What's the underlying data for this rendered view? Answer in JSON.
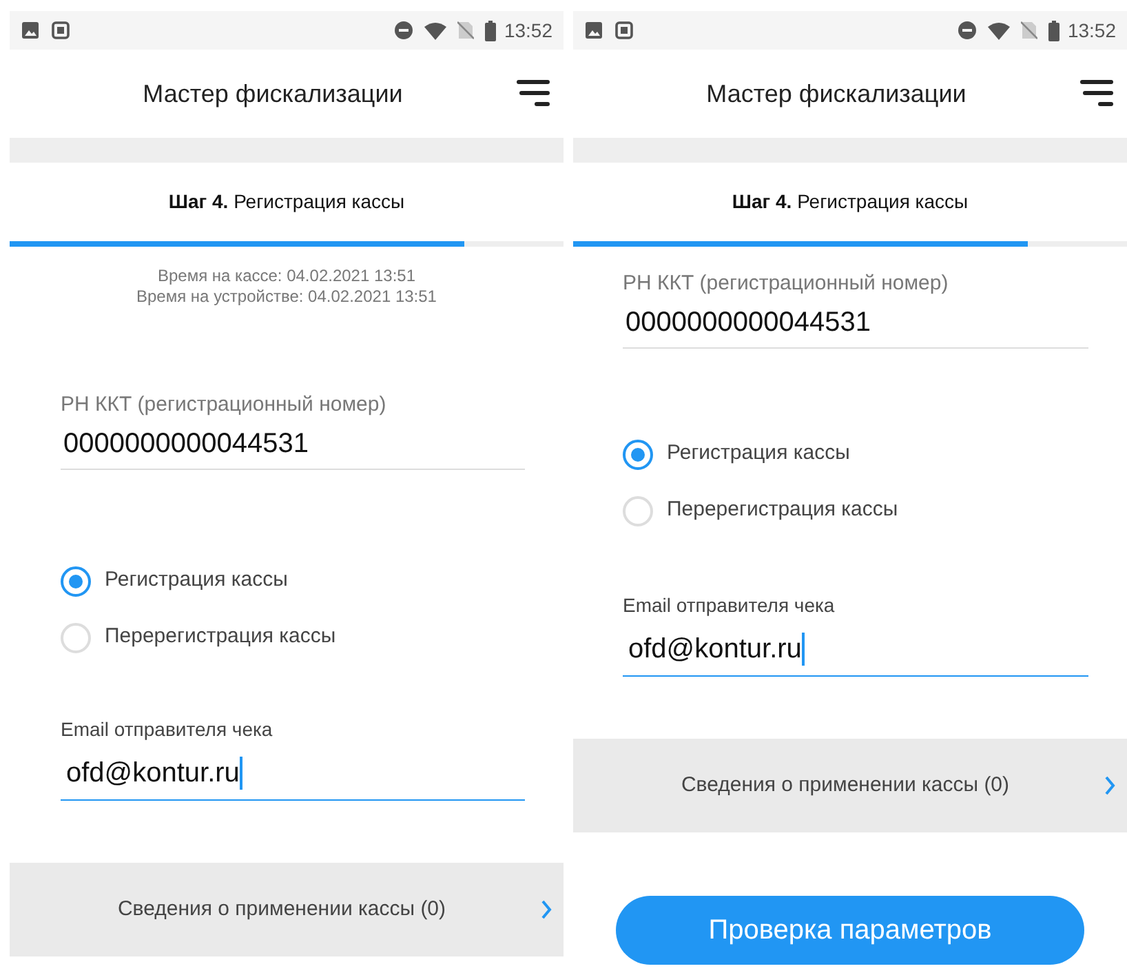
{
  "screens": [
    {
      "status_bar": {
        "time": "13:52"
      },
      "title": "Мастер фискализации",
      "step": {
        "number": "Шаг 4.",
        "name": "Регистрация кассы",
        "level": 0.82
      },
      "times": [
        "Время на кассе: 04.02.2021 13:51",
        "Время на устройстве: 04.02.2021 13:51"
      ],
      "reg_number": {
        "label": "РН ККТ (регистрационный номер)",
        "value": "0000000000044531"
      },
      "radios": [
        {
          "label": "Регистрация кассы",
          "selected": true
        },
        {
          "label": "Перерегистрация кассы",
          "selected": false
        }
      ],
      "email": {
        "label": "Email отправителя чека",
        "value": "ofd@kontur.ru",
        "focused": true
      },
      "info_row": "Сведения о применении кассы (0)"
    },
    {
      "status_bar": {
        "time": "13:52"
      },
      "title": "Мастер фискализации",
      "step": {
        "number": "Шаг 4.",
        "name": "Регистрация кассы",
        "level": 0.82
      },
      "reg_number": {
        "label": "РН ККТ (регистрационный номер)",
        "value": "0000000000044531"
      },
      "radios": [
        {
          "label": "Регистрация кассы",
          "selected": true
        },
        {
          "label": "Перерегистрация кассы",
          "selected": false
        }
      ],
      "email": {
        "label": "Email отправителя чека",
        "value": "ofd@kontur.ru",
        "focused": true
      },
      "info_row": "Сведения о применении кассы (0)",
      "button": "Проверка параметров"
    }
  ]
}
